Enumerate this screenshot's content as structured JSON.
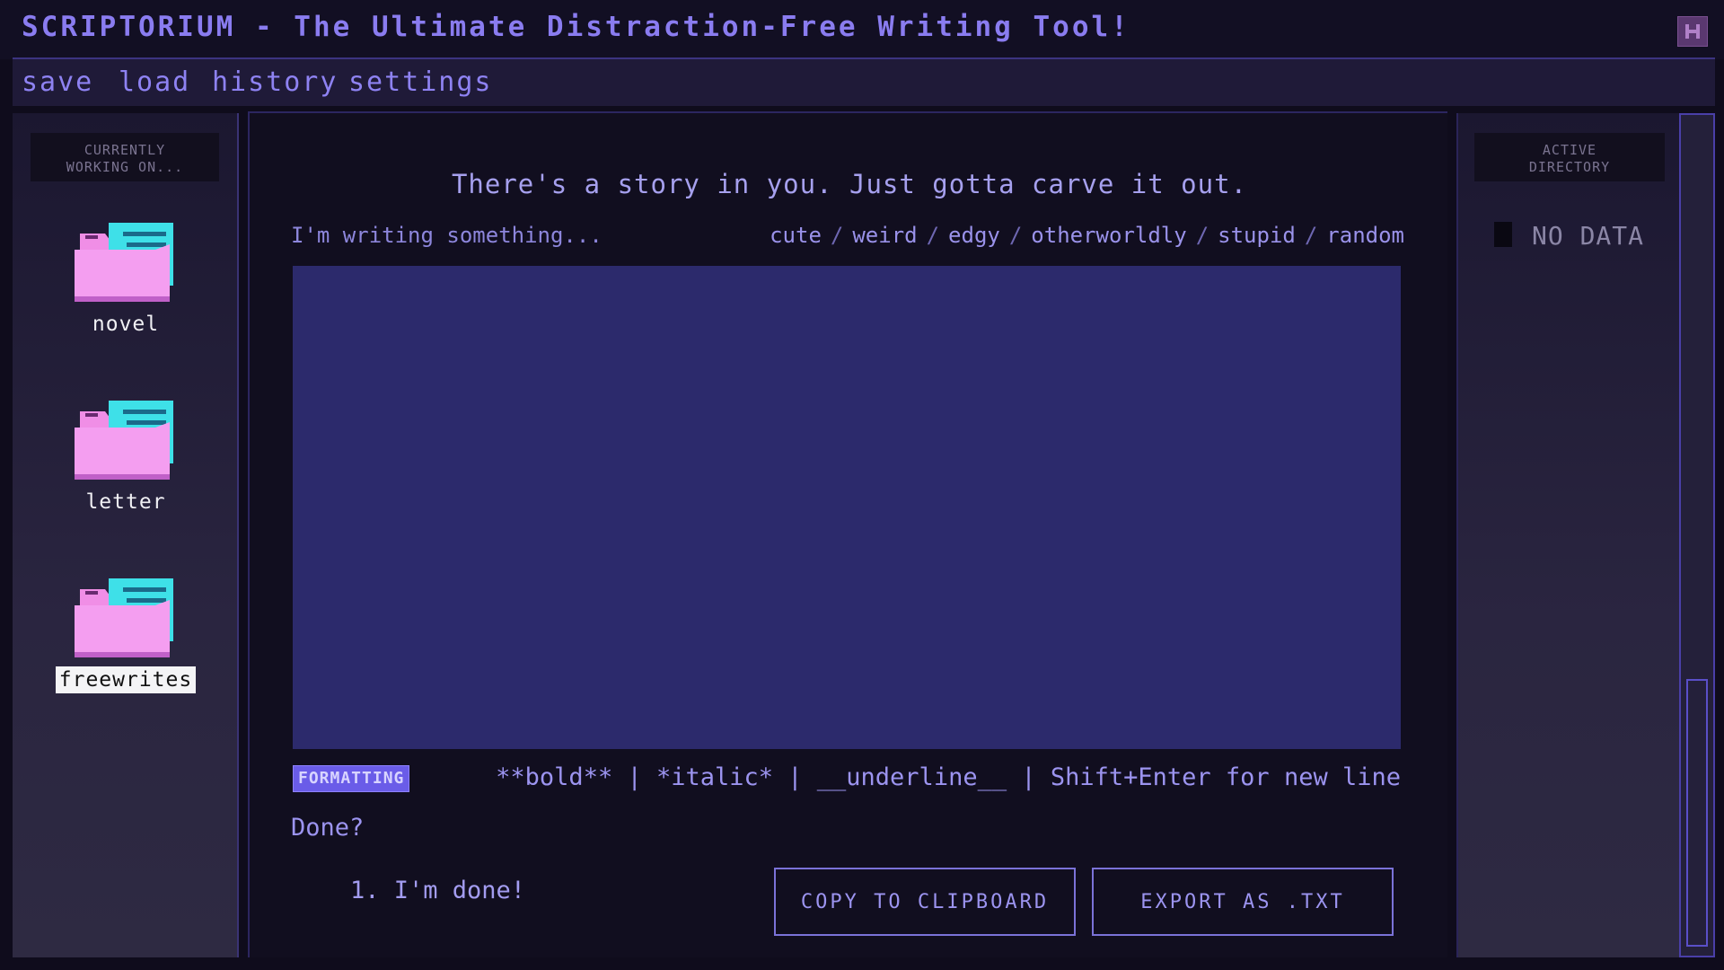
{
  "window": {
    "title": "SCRIPTORIUM - The Ultimate Distraction-Free Writing Tool!",
    "close_icon": "close-x-icon"
  },
  "menu": {
    "items": [
      {
        "label": "save"
      },
      {
        "label": "load"
      },
      {
        "label": "history"
      },
      {
        "label": "settings"
      }
    ]
  },
  "left_panel": {
    "header": "CURRENTLY\nWORKING ON...",
    "folders": [
      {
        "label": "novel",
        "icon": "folder-icon",
        "selected": false
      },
      {
        "label": "letter",
        "icon": "folder-icon",
        "selected": false
      },
      {
        "label": "freewrites",
        "icon": "folder-icon",
        "selected": true
      }
    ]
  },
  "editor": {
    "tagline": "There's a story in you. Just gotta carve it out.",
    "writing_label": "I'm writing something...",
    "genres": [
      "cute",
      "weird",
      "edgy",
      "otherworldly",
      "stupid",
      "random"
    ],
    "genre_separator": "/",
    "content": "",
    "formatting_badge": "FORMATTING",
    "formatting_hint": "**bold** | *italic* | __underline__ | Shift+Enter for new line",
    "done_label": "Done?",
    "done_option": "1. I'm done!",
    "copy_button": "COPY TO CLIPBOARD",
    "export_button": "EXPORT AS .TXT"
  },
  "right_panel": {
    "header": "ACTIVE\nDIRECTORY",
    "status": "NO DATA"
  },
  "colors": {
    "background": "#0f0c1c",
    "accent": "#8a7cf0",
    "editor_bg": "#2c2a6c",
    "folder_pink": "#f08ee6",
    "folder_cyan": "#3ee0e8"
  }
}
